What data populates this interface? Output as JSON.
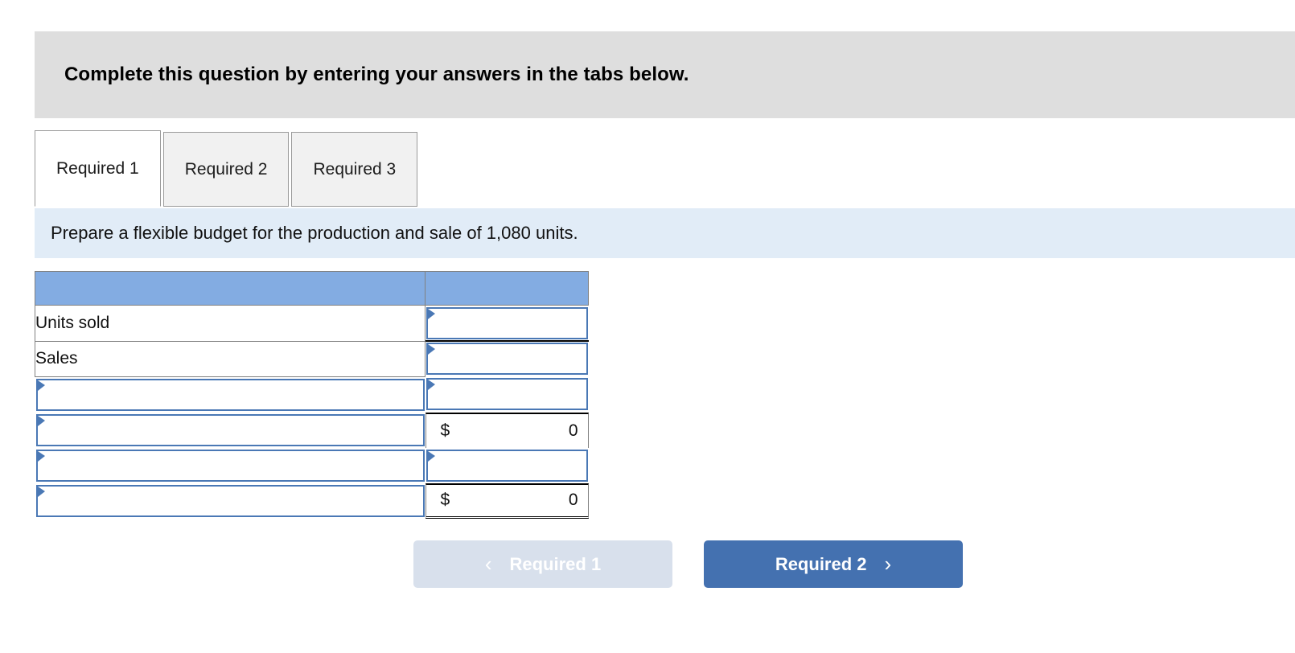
{
  "question_banner": {
    "text": "Complete this question by entering your answers in the tabs below."
  },
  "tabs": [
    {
      "label": "Required 1",
      "active": true
    },
    {
      "label": "Required 2",
      "active": false
    },
    {
      "label": "Required 3",
      "active": false
    }
  ],
  "requirement_banner": {
    "text": "Prepare a flexible budget for the production and sale of 1,080 units."
  },
  "worksheet": {
    "header": {
      "label_col": "",
      "value_col": ""
    },
    "rows": [
      {
        "type": "text-input",
        "label": "Units sold",
        "value": "",
        "currency": "",
        "rule_under": true
      },
      {
        "type": "text-input",
        "label": "Sales",
        "value": "",
        "currency": "",
        "rule_under": false
      },
      {
        "type": "select-input",
        "label": "",
        "value": "",
        "currency": "",
        "rule_under": false
      },
      {
        "type": "select-total",
        "label": "",
        "value": "0",
        "currency": "$",
        "double_rule": false
      },
      {
        "type": "select-input",
        "label": "",
        "value": "",
        "currency": "",
        "rule_under": false
      },
      {
        "type": "select-total",
        "label": "",
        "value": "0",
        "currency": "$",
        "double_rule": true
      }
    ]
  },
  "nav": {
    "prev": {
      "label": "Required 1",
      "chevron": "chevron-left-icon",
      "glyph": "‹",
      "enabled": false
    },
    "next": {
      "label": "Required 2",
      "chevron": "chevron-right-icon",
      "glyph": "›",
      "enabled": true
    }
  },
  "colors": {
    "banner_gray": "#dedede",
    "banner_blue": "#e1ecf7",
    "table_header_blue": "#83ace2",
    "control_border_blue": "#4a78b5",
    "next_button_blue": "#4471b0",
    "prev_button_blue": "#d8e0ec"
  }
}
